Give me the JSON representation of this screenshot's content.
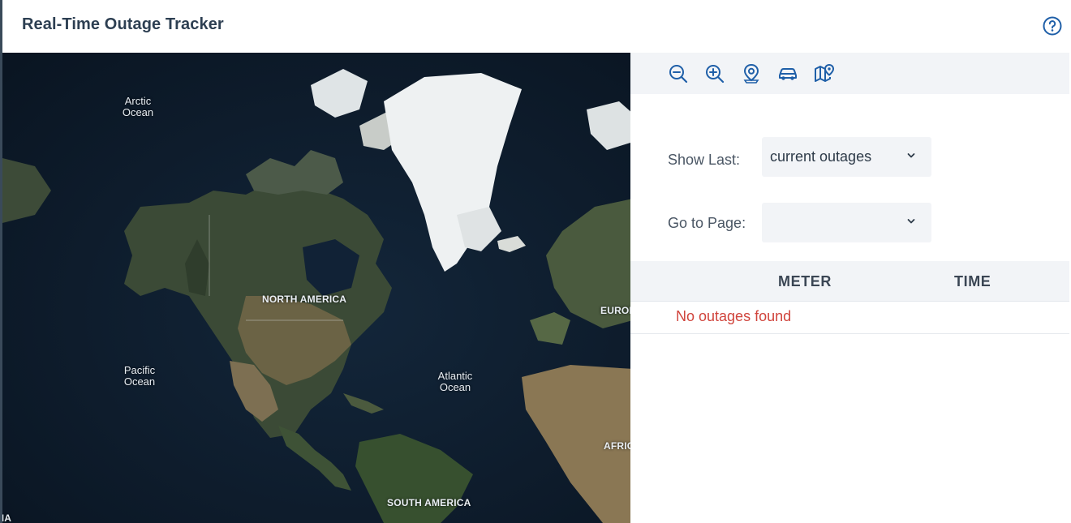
{
  "header": {
    "title": "Real-Time Outage Tracker",
    "help_icon": "help-circle-icon"
  },
  "map": {
    "labels": {
      "arctic_ocean": "Arctic\nOcean",
      "pacific_ocean": "Pacific\nOcean",
      "atlantic_ocean": "Atlantic\nOcean",
      "north_america": "NORTH AMERICA",
      "south_america": "SOUTH AMERICA",
      "europe": "EUROPE",
      "africa": "AFRICA",
      "australia": "AUSTRALIA"
    }
  },
  "toolbar": {
    "icons": [
      "zoom-out-icon",
      "zoom-in-icon",
      "map-pin-icon",
      "vehicle-icon",
      "map-marker-icon"
    ]
  },
  "filters": {
    "show_last_label": "Show Last:",
    "show_last_value": "current outages",
    "go_to_page_label": "Go to Page:",
    "go_to_page_value": ""
  },
  "table": {
    "columns": [
      "METER",
      "TIME"
    ],
    "empty_message": "No outages found"
  },
  "colors": {
    "accent": "#1f5fa8",
    "error": "#d0443c",
    "toolbar_bg": "#f2f4f7",
    "header_text": "#2d3f52"
  }
}
